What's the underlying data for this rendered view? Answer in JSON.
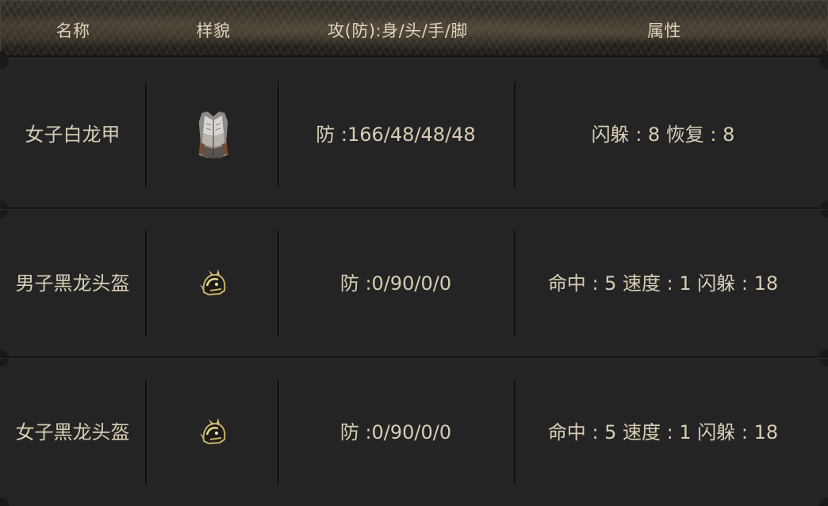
{
  "header": {
    "col_name": "名称",
    "col_look": "样貌",
    "col_stats": "攻(防):身/头/手/脚",
    "col_attr": "属性"
  },
  "rows": [
    {
      "name": "女子白龙甲",
      "icon": "white-armor-icon",
      "stats": "防 :166/48/48/48",
      "attr": "闪躲 : 8 恢复 : 8"
    },
    {
      "name": "男子黑龙头盔",
      "icon": "black-helmet-icon",
      "stats": "防 :0/90/0/0",
      "attr": "命中 : 5 速度 : 1 闪躲 : 18"
    },
    {
      "name": "女子黑龙头盔",
      "icon": "black-helmet-icon",
      "stats": "防 :0/90/0/0",
      "attr": "命中 : 5 速度 : 1 闪躲 : 18"
    }
  ]
}
